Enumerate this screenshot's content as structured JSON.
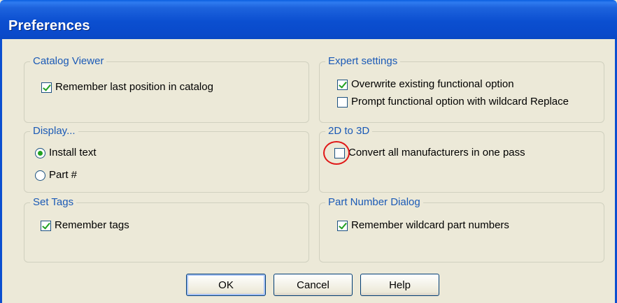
{
  "window": {
    "title": "Preferences"
  },
  "groups": {
    "catalog_viewer": {
      "label": "Catalog Viewer",
      "options": [
        {
          "label": "Remember last position in catalog",
          "checked": true
        }
      ]
    },
    "expert_settings": {
      "label": "Expert settings",
      "options": [
        {
          "label": "Overwrite existing functional option",
          "checked": true
        },
        {
          "label": "Prompt functional option with wildcard Replace",
          "checked": false
        }
      ]
    },
    "display": {
      "label": "Display...",
      "options": [
        {
          "label": "Install text",
          "selected": true
        },
        {
          "label": "Part #",
          "selected": false
        }
      ]
    },
    "two_d_to_three_d": {
      "label": "2D to 3D",
      "options": [
        {
          "label": "Convert all manufacturers in one pass",
          "checked": false
        }
      ]
    },
    "set_tags": {
      "label": "Set Tags",
      "options": [
        {
          "label": "Remember tags",
          "checked": true
        }
      ]
    },
    "part_number_dialog": {
      "label": "Part Number Dialog",
      "options": [
        {
          "label": "Remember wildcard part numbers",
          "checked": true
        }
      ]
    }
  },
  "buttons": {
    "ok": "OK",
    "cancel": "Cancel",
    "help": "Help"
  },
  "colors": {
    "titlebar": "#0b4fd0",
    "group_label": "#1b5ab6",
    "dialog_bg": "#ece9d8",
    "annotation": "#e01818"
  }
}
